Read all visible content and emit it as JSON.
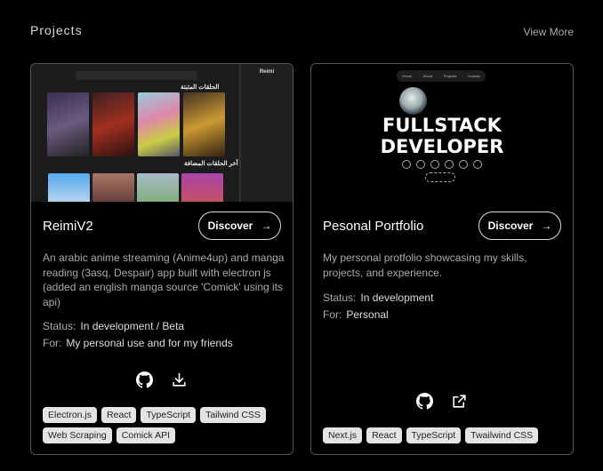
{
  "section": {
    "title": "Projects",
    "view_more": "View More"
  },
  "projects": [
    {
      "title": "ReimiV2",
      "discover": "Discover",
      "description": "An arabic anime streaming (Anime4up) and manga reading (3asq, Despair) app built with electron js (added an english manga source 'Comick' using its api)",
      "status_label": "Status:",
      "status": "In development / Beta",
      "for_label": "For:",
      "for": "My personal use and for my friends",
      "icons": [
        "github-icon",
        "download-icon"
      ],
      "tags": [
        "Electron.js",
        "React",
        "TypeScript",
        "Tailwind CSS",
        "Web Scraping",
        "Comick API"
      ],
      "preview": {
        "sidebar_title": "Reimi",
        "heading_1": "الحلقات المثبتة",
        "heading_2": "آخر الحلقات المضافة"
      }
    },
    {
      "title": "Pesonal Portfolio",
      "discover": "Discover",
      "description": "My personal protfolio showcasing my skills, projects, and experience.",
      "status_label": "Status:",
      "status": "In development",
      "for_label": "For:",
      "for": "Personal",
      "icons": [
        "github-icon",
        "external-link-icon"
      ],
      "tags": [
        "Next.js",
        "React",
        "TypeScript",
        "Twailwind CSS"
      ],
      "preview": {
        "nav": [
          "Home",
          "About",
          "Projects",
          "Contact"
        ],
        "headline_1": "FULLSTACK",
        "headline_2": "DEVELOPER"
      }
    }
  ]
}
